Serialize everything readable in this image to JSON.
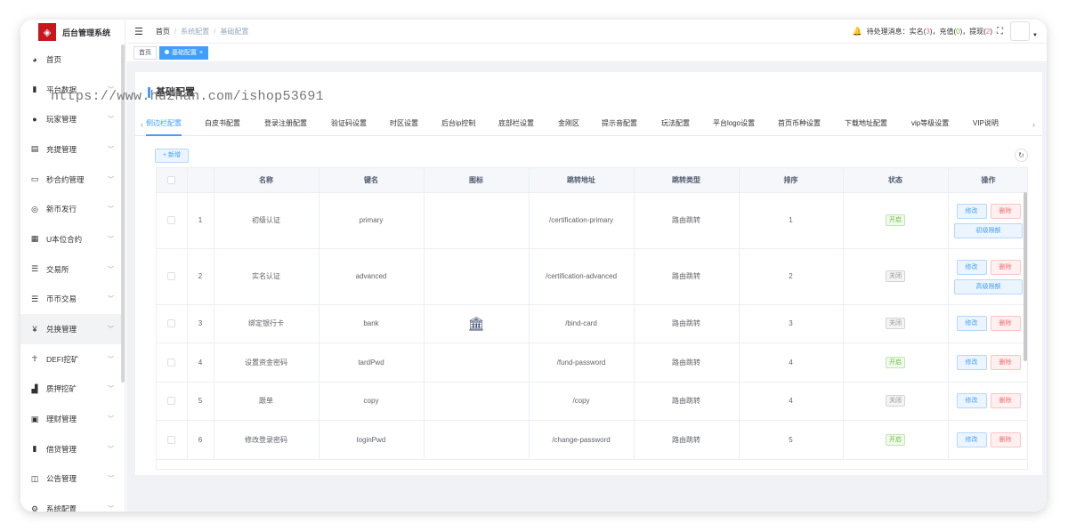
{
  "app": {
    "title": "后台管理系统"
  },
  "sidebar": {
    "items": [
      {
        "label": "首页",
        "icon": "dashboard-icon",
        "glyph": "◕",
        "arrow": false,
        "active": false
      },
      {
        "label": "平台数据",
        "icon": "book-icon",
        "glyph": "▮",
        "arrow": true,
        "active": false
      },
      {
        "label": "玩家管理",
        "icon": "user-icon",
        "glyph": "●",
        "arrow": true,
        "active": false
      },
      {
        "label": "充提管理",
        "icon": "documents-icon",
        "glyph": "▤",
        "arrow": true,
        "active": false
      },
      {
        "label": "秒合约管理",
        "icon": "monitor-icon",
        "glyph": "▭",
        "arrow": true,
        "active": false
      },
      {
        "label": "新币发行",
        "icon": "coin-icon",
        "glyph": "◎",
        "arrow": true,
        "active": false
      },
      {
        "label": "U本位合约",
        "icon": "grid-icon",
        "glyph": "▦",
        "arrow": true,
        "active": false
      },
      {
        "label": "交易所",
        "icon": "list-icon",
        "glyph": "☰",
        "arrow": true,
        "active": false
      },
      {
        "label": "币币交易",
        "icon": "list-icon",
        "glyph": "☰",
        "arrow": true,
        "active": false
      },
      {
        "label": "兑换管理",
        "icon": "yen-icon",
        "glyph": "¥",
        "arrow": true,
        "active": true
      },
      {
        "label": "DEFI挖矿",
        "icon": "miner-icon",
        "glyph": "☥",
        "arrow": true,
        "active": false
      },
      {
        "label": "质押挖矿",
        "icon": "bar-chart-icon",
        "glyph": "▟",
        "arrow": true,
        "active": false
      },
      {
        "label": "理财管理",
        "icon": "wallet-icon",
        "glyph": "▣",
        "arrow": true,
        "active": false
      },
      {
        "label": "借贷管理",
        "icon": "book-icon",
        "glyph": "▮",
        "arrow": true,
        "active": false
      },
      {
        "label": "公告管理",
        "icon": "open-book-icon",
        "glyph": "◫",
        "arrow": true,
        "active": false
      },
      {
        "label": "系统配置",
        "icon": "settings-icon",
        "glyph": "⚙",
        "arrow": true,
        "active": false
      }
    ]
  },
  "header": {
    "breadcrumb": [
      "首页",
      "系统配置",
      "基础配置"
    ],
    "notice_prefix": "待处理消息：实名(",
    "notice_realname_count": "3",
    "notice_mid1": ")，充值(",
    "notice_recharge_count": "0",
    "notice_mid2": ")，提现(",
    "notice_withdraw_count": "2",
    "notice_suffix": ")"
  },
  "tags": {
    "home": "首页",
    "current": "基础配置"
  },
  "watermark": "https://www.huzhan.com/ishop53691",
  "page": {
    "title": "基础配置"
  },
  "config_tabs": {
    "items": [
      "侧边栏配置",
      "白皮书配置",
      "登录注册配置",
      "验证码设置",
      "时区设置",
      "后台ip控制",
      "底部栏设置",
      "金刚区",
      "提示音配置",
      "玩法配置",
      "平台logo设置",
      "首页币种设置",
      "下载地址配置",
      "vip等级设置",
      "VIP说明"
    ],
    "active_index": 0
  },
  "toolbar": {
    "add_label": "+ 新增"
  },
  "table": {
    "columns": [
      "",
      "",
      "名称",
      "键名",
      "图标",
      "跳转地址",
      "跳转类型",
      "排序",
      "状态",
      "操作"
    ],
    "rows": [
      {
        "index": "1",
        "name": "初级认证",
        "key": "primary",
        "icon": "",
        "url": "/certification-primary",
        "jump_type": "路由跳转",
        "sort": "1",
        "status": "开启",
        "status_on": true,
        "extra": "初级限额"
      },
      {
        "index": "2",
        "name": "实名认证",
        "key": "advanced",
        "icon": "",
        "url": "/certification-advanced",
        "jump_type": "路由跳转",
        "sort": "2",
        "status": "关闭",
        "status_on": false,
        "extra": "高级限额"
      },
      {
        "index": "3",
        "name": "绑定银行卡",
        "key": "bank",
        "icon": "bank-icon",
        "url": "/bind-card",
        "jump_type": "路由跳转",
        "sort": "3",
        "status": "关闭",
        "status_on": false,
        "extra": ""
      },
      {
        "index": "4",
        "name": "设置资金密码",
        "key": "tardPwd",
        "icon": "",
        "url": "/fund-password",
        "jump_type": "路由跳转",
        "sort": "4",
        "status": "开启",
        "status_on": true,
        "extra": ""
      },
      {
        "index": "5",
        "name": "跟单",
        "key": "copy",
        "icon": "",
        "url": "/copy",
        "jump_type": "路由跳转",
        "sort": "4",
        "status": "关闭",
        "status_on": false,
        "extra": ""
      },
      {
        "index": "6",
        "name": "修改登录密码",
        "key": "loginPwd",
        "icon": "",
        "url": "/change-password",
        "jump_type": "路由跳转",
        "sort": "5",
        "status": "开启",
        "status_on": true,
        "extra": ""
      }
    ],
    "edit_label": "修改",
    "delete_label": "删除"
  },
  "colors": {
    "accent": "#409eff",
    "brand": "#c8161d",
    "success": "#67c23a",
    "danger": "#f56c6c"
  }
}
